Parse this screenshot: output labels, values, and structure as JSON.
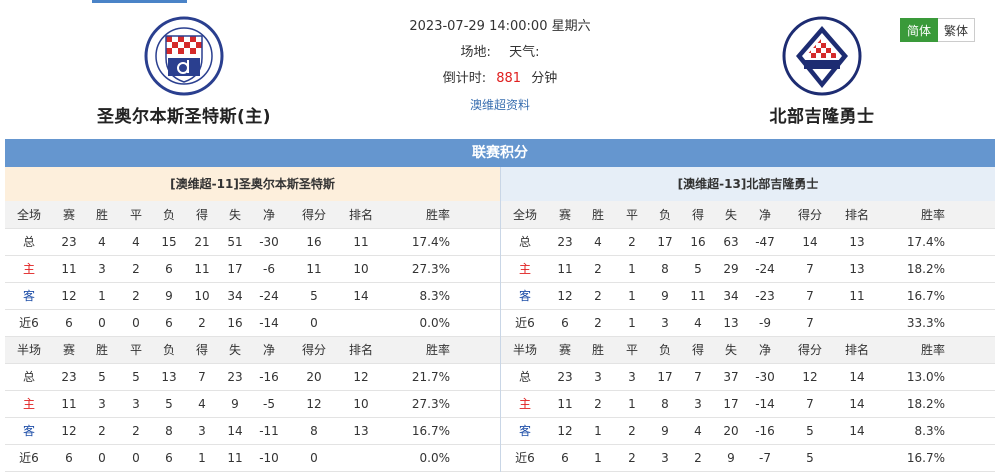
{
  "match": {
    "datetime": "2023-07-29 14:00:00 星期六",
    "venue_label": "场地:",
    "weather_label": "天气:",
    "countdown_label": "倒计时:",
    "countdown_value": "881",
    "countdown_unit": "分钟",
    "league_link": "澳维超资料"
  },
  "home_team": {
    "name": "圣奥尔本斯圣特斯(主)",
    "logo": "st-albans-saints-logo"
  },
  "away_team": {
    "name": "北部吉隆勇士",
    "logo": "north-geelong-warriors-logo"
  },
  "lang": {
    "simplified": "简体",
    "traditional": "繁体"
  },
  "standings": {
    "title": "联赛积分",
    "home_title": "[澳维超-11]圣奥尔本斯圣特斯",
    "away_title": "[澳维超-13]北部吉隆勇士",
    "colors": {
      "home_row_label": "#e02020",
      "away_row_label": "#1f4fa8"
    },
    "full_header": [
      "全场",
      "赛",
      "胜",
      "平",
      "负",
      "得",
      "失",
      "净",
      "得分",
      "排名",
      "胜率"
    ],
    "half_header": [
      "半场",
      "赛",
      "胜",
      "平",
      "负",
      "得",
      "失",
      "净",
      "得分",
      "排名",
      "胜率"
    ],
    "home_full": [
      [
        "总",
        "23",
        "4",
        "4",
        "15",
        "21",
        "51",
        "-30",
        "16",
        "11",
        "17.4%"
      ],
      [
        "主",
        "11",
        "3",
        "2",
        "6",
        "11",
        "17",
        "-6",
        "11",
        "10",
        "27.3%"
      ],
      [
        "客",
        "12",
        "1",
        "2",
        "9",
        "10",
        "34",
        "-24",
        "5",
        "14",
        "8.3%"
      ],
      [
        "近6",
        "6",
        "0",
        "0",
        "6",
        "2",
        "16",
        "-14",
        "0",
        "",
        "0.0%"
      ]
    ],
    "away_full": [
      [
        "总",
        "23",
        "4",
        "2",
        "17",
        "16",
        "63",
        "-47",
        "14",
        "13",
        "17.4%"
      ],
      [
        "主",
        "11",
        "2",
        "1",
        "8",
        "5",
        "29",
        "-24",
        "7",
        "13",
        "18.2%"
      ],
      [
        "客",
        "12",
        "2",
        "1",
        "9",
        "11",
        "34",
        "-23",
        "7",
        "11",
        "16.7%"
      ],
      [
        "近6",
        "6",
        "2",
        "1",
        "3",
        "4",
        "13",
        "-9",
        "7",
        "",
        "33.3%"
      ]
    ],
    "home_half": [
      [
        "总",
        "23",
        "5",
        "5",
        "13",
        "7",
        "23",
        "-16",
        "20",
        "12",
        "21.7%"
      ],
      [
        "主",
        "11",
        "3",
        "3",
        "5",
        "4",
        "9",
        "-5",
        "12",
        "10",
        "27.3%"
      ],
      [
        "客",
        "12",
        "2",
        "2",
        "8",
        "3",
        "14",
        "-11",
        "8",
        "13",
        "16.7%"
      ],
      [
        "近6",
        "6",
        "0",
        "0",
        "6",
        "1",
        "11",
        "-10",
        "0",
        "",
        "0.0%"
      ]
    ],
    "away_half": [
      [
        "总",
        "23",
        "3",
        "3",
        "17",
        "7",
        "37",
        "-30",
        "12",
        "14",
        "13.0%"
      ],
      [
        "主",
        "11",
        "2",
        "1",
        "8",
        "3",
        "17",
        "-14",
        "7",
        "14",
        "18.2%"
      ],
      [
        "客",
        "12",
        "1",
        "2",
        "9",
        "4",
        "20",
        "-16",
        "5",
        "14",
        "8.3%"
      ],
      [
        "近6",
        "6",
        "1",
        "2",
        "3",
        "2",
        "9",
        "-7",
        "5",
        "",
        "16.7%"
      ]
    ]
  }
}
